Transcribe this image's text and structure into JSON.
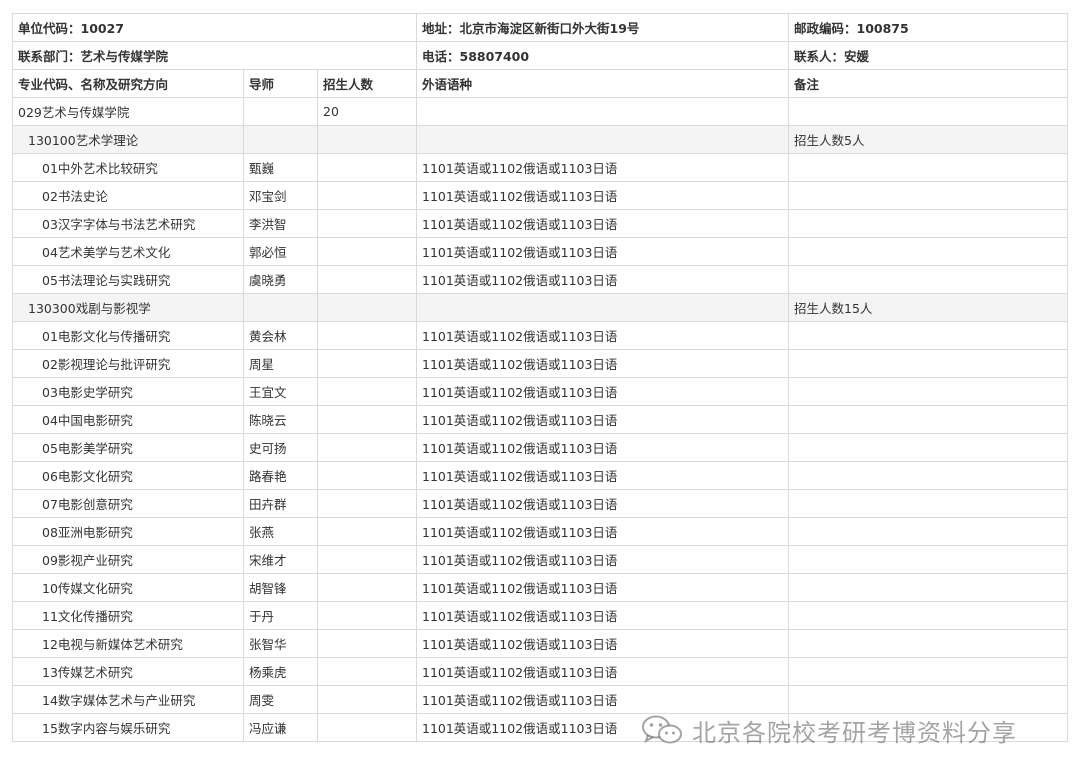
{
  "header": {
    "unit_code": "单位代码：10027",
    "address": "地址：北京市海淀区新街口外大街19号",
    "postal": "邮政编码：100875",
    "dept": "联系部门：艺术与传媒学院",
    "phone": "电话：58807400",
    "contact": "联系人：安媛"
  },
  "columns": [
    "专业代码、名称及研究方向",
    "导师",
    "招生人数",
    "外语语种",
    "备注"
  ],
  "college": {
    "name": "029艺术与传媒学院",
    "count": "20"
  },
  "subjects": [
    {
      "name": "130100艺术学理论",
      "note": "招生人数5人",
      "directions": [
        {
          "name": "01中外艺术比较研究",
          "advisor": "甄巍",
          "lang": "1101英语或1102俄语或1103日语"
        },
        {
          "name": "02书法史论",
          "advisor": "邓宝剑",
          "lang": "1101英语或1102俄语或1103日语"
        },
        {
          "name": "03汉字字体与书法艺术研究",
          "advisor": "李洪智",
          "lang": "1101英语或1102俄语或1103日语"
        },
        {
          "name": "04艺术美学与艺术文化",
          "advisor": "郭必恒",
          "lang": "1101英语或1102俄语或1103日语"
        },
        {
          "name": "05书法理论与实践研究",
          "advisor": "虞晓勇",
          "lang": "1101英语或1102俄语或1103日语"
        }
      ]
    },
    {
      "name": "130300戏剧与影视学",
      "note": "招生人数15人",
      "directions": [
        {
          "name": "01电影文化与传播研究",
          "advisor": "黄会林",
          "lang": "1101英语或1102俄语或1103日语"
        },
        {
          "name": "02影视理论与批评研究",
          "advisor": "周星",
          "lang": "1101英语或1102俄语或1103日语"
        },
        {
          "name": "03电影史学研究",
          "advisor": "王宜文",
          "lang": "1101英语或1102俄语或1103日语"
        },
        {
          "name": "04中国电影研究",
          "advisor": "陈晓云",
          "lang": "1101英语或1102俄语或1103日语"
        },
        {
          "name": "05电影美学研究",
          "advisor": "史可扬",
          "lang": "1101英语或1102俄语或1103日语"
        },
        {
          "name": "06电影文化研究",
          "advisor": "路春艳",
          "lang": "1101英语或1102俄语或1103日语"
        },
        {
          "name": "07电影创意研究",
          "advisor": "田卉群",
          "lang": "1101英语或1102俄语或1103日语"
        },
        {
          "name": "08亚洲电影研究",
          "advisor": "张燕",
          "lang": "1101英语或1102俄语或1103日语"
        },
        {
          "name": "09影视产业研究",
          "advisor": "宋维才",
          "lang": "1101英语或1102俄语或1103日语"
        },
        {
          "name": "10传媒文化研究",
          "advisor": "胡智锋",
          "lang": "1101英语或1102俄语或1103日语"
        },
        {
          "name": "11文化传播研究",
          "advisor": "于丹",
          "lang": "1101英语或1102俄语或1103日语"
        },
        {
          "name": "12电视与新媒体艺术研究",
          "advisor": "张智华",
          "lang": "1101英语或1102俄语或1103日语"
        },
        {
          "name": "13传媒艺术研究",
          "advisor": "杨乘虎",
          "lang": "1101英语或1102俄语或1103日语"
        },
        {
          "name": "14数字媒体艺术与产业研究",
          "advisor": "周雯",
          "lang": "1101英语或1102俄语或1103日语"
        },
        {
          "name": "15数字内容与娱乐研究",
          "advisor": "冯应谦",
          "lang": "1101英语或1102俄语或1103日语"
        }
      ]
    }
  ],
  "watermark": {
    "text": "北京各院校考研考博资料分享",
    "icon": "wechat-icon"
  }
}
